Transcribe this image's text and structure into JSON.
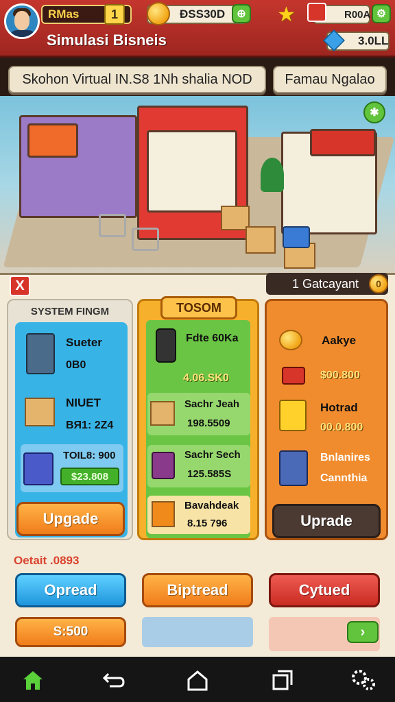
{
  "header": {
    "player_name": "RMas",
    "level": "1",
    "coins": "ĐSS30D",
    "star_value": "R00A",
    "gem_value": "3.0LL",
    "title": "Simulasi Bisneis"
  },
  "banners": {
    "left": "Skohon Virtual IN.S8 1Nh shalia NOD",
    "right": "Famau Ngalao"
  },
  "panel": {
    "category_label": "1 Gatcayant",
    "category_count": "0",
    "close_label": "X",
    "col1": {
      "title": "SYSTEM FINGM",
      "item1": {
        "label": "Sueter",
        "value": "0B0"
      },
      "item2": {
        "label": "NIUET",
        "value": "BЯ1: 2Z4"
      },
      "item3": {
        "label": "TOIL8: 900",
        "value": "$23.808"
      },
      "button": "Upgade"
    },
    "col2": {
      "tab": "TOSOM",
      "item1": {
        "label": "Fdte 60Ka",
        "value": "4.06.SK0"
      },
      "item2": {
        "label": "Sachr Jeah",
        "value": "198.5509"
      },
      "item3": {
        "label": "Sachr Sech",
        "value": "125.585S"
      },
      "item4": {
        "label": "Bavahdeak",
        "value": "8.15 796"
      }
    },
    "col3": {
      "item1": {
        "label": "Aakye",
        "value": "$00.800"
      },
      "item2": {
        "label": "Hotrad",
        "value": "00.0.800"
      },
      "item3": {
        "label": "Bnlanires",
        "label2": "Cannthia"
      },
      "button": "Uprade"
    },
    "footer_label": "Oetait .0893",
    "btn_blue": "Opread",
    "btn_orange": "Biptread",
    "btn_red": "Cytued",
    "btn_small": "S:500"
  },
  "icons": {
    "nav": [
      "home-icon",
      "back-icon",
      "house-outline-icon",
      "recent-apps-icon",
      "gears-icon"
    ]
  },
  "colors": {
    "accent_red": "#c4362d",
    "accent_green": "#61c43c",
    "accent_orange": "#f07c1a",
    "accent_blue": "#1e96dd"
  }
}
